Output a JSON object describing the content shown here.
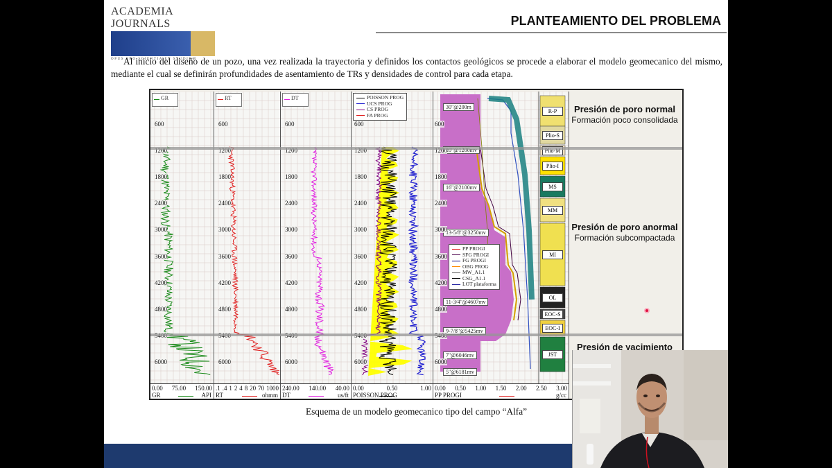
{
  "header": {
    "logo_text": "ACADEMIA JOURNALS",
    "logo_tagline": "OPUS PRO SCIENTIA ET STUDIUM",
    "title": "PLANTEAMIENTO DEL PROBLEMA"
  },
  "intro_text": "Al inicio del diseño de un pozo, una vez realizada la trayectoria y definidos los contactos geológicos se procede a elaborar el modelo geomecanico del mismo, mediante el cual se definirán profundidades de asentamiento de TRs y densidades de control para cada etapa.",
  "figure": {
    "depth_labels": [
      "600",
      "1200",
      "1800",
      "2400",
      "3000",
      "3600",
      "4200",
      "4800",
      "5400",
      "6000"
    ],
    "tracks": [
      {
        "header": "GR",
        "name": "GR",
        "unit": "API",
        "ticks": [
          "0.00",
          "75.00",
          "150.00"
        ],
        "color": "#1a8a1a"
      },
      {
        "header": "RT",
        "name": "RT",
        "unit": "ohmm",
        "ticks": [
          ".1",
          ".4",
          "1",
          "2",
          "4",
          "8",
          "20",
          "70",
          "1000"
        ],
        "color": "#e02020"
      },
      {
        "header": "DT",
        "name": "DT",
        "unit": "us/ft",
        "ticks": [
          "240.00",
          "140.00",
          "40.00"
        ],
        "color": "#e020e0"
      },
      {
        "header": "",
        "name": "POISSON PROG",
        "unit": "",
        "ticks": [
          "0.00",
          "0.50",
          "1.00"
        ],
        "color": "#000000"
      },
      {
        "header": "",
        "name": "PP PROGI",
        "unit": "g/cc",
        "ticks": [
          "0.00",
          "0.50",
          "1.00",
          "1.50",
          "2.00",
          "2.50",
          "3.00"
        ],
        "color": "#e02020"
      }
    ],
    "poisson_legend": [
      "POISSON PROG",
      "UCS PROG",
      "CS PROG",
      "FA PROG"
    ],
    "pressure_legend": [
      "PP PROGI",
      "SFG PROGI",
      "FG PROGI",
      "OBG PROG",
      "MW_A1.1",
      "CSG_A1.1",
      "LOT plataforma"
    ],
    "casings": [
      "30\"@200m",
      "20\"@1200mv",
      "16\"@2100mv",
      "13-5/8\"@3250mv",
      "11-3/4\"@4607mv",
      "9-7/8\"@5425mv",
      "7\"@6046mv",
      "5\"@6181mv"
    ],
    "formations": [
      "R-P",
      "Plio-S",
      "Plio-M",
      "Plio-I",
      "MS",
      "MM",
      "MI",
      "OL",
      "EOC-S",
      "EOC-I",
      "JST"
    ],
    "zones": [
      {
        "title": "Presión de poro normal",
        "desc": "Formación poco consolidada"
      },
      {
        "title": "Presión de poro anormal",
        "desc": "Formación subcompactada"
      },
      {
        "title": "Presión de yacimiento",
        "desc": ""
      }
    ]
  },
  "caption": "Esquema de un modelo geomecanico tipo del campo “Alfa”",
  "colors": {
    "footer": "#1e3a6e",
    "logo_blue": "#2b4c9b",
    "logo_gold": "#d8b866"
  }
}
